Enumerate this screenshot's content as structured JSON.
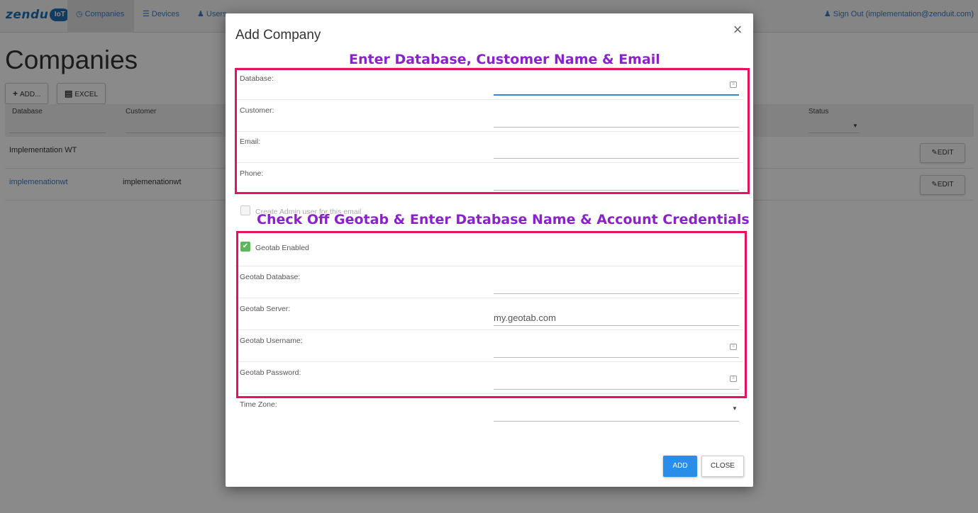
{
  "nav": {
    "brand": "zendu",
    "brand_badge": "IoT",
    "items": [
      {
        "label": "Companies",
        "icon": "clock"
      },
      {
        "label": "Devices",
        "icon": "list"
      },
      {
        "label": "Users",
        "icon": "user"
      }
    ],
    "signout": "Sign Out (implementation@zenduit.com)"
  },
  "page": {
    "title": "Companies",
    "add_label": "ADD...",
    "excel_label": "EXCEL",
    "columns": [
      "Database",
      "Customer",
      "Status"
    ],
    "rows": [
      {
        "database": "Implementation WT",
        "customer": "",
        "action": "EDIT"
      },
      {
        "database": "implemenationwt",
        "customer": "implemenationwt",
        "action": "EDIT"
      }
    ]
  },
  "modal": {
    "title": "Add Company",
    "close_glyph": "×",
    "fields": {
      "database": {
        "label": "Database:",
        "value": ""
      },
      "customer": {
        "label": "Customer:",
        "value": ""
      },
      "email": {
        "label": "Email:",
        "value": ""
      },
      "phone": {
        "label": "Phone:",
        "value": ""
      }
    },
    "create_admin": {
      "label": "Create Admin user for this email",
      "checked": false
    },
    "geotab_enabled": {
      "label": "Geotab Enabled",
      "checked": true
    },
    "geotab_fields": {
      "database": {
        "label": "Geotab Database:",
        "value": ""
      },
      "server": {
        "label": "Geotab Server:",
        "value": "my.geotab.com"
      },
      "username": {
        "label": "Geotab Username:",
        "value": ""
      },
      "password": {
        "label": "Geotab Password:",
        "value": ""
      }
    },
    "timezone": {
      "label": "Time Zone:",
      "value": ""
    },
    "add_button": "ADD",
    "close_button": "CLOSE"
  },
  "annotations": {
    "top": "Enter Database, Customer Name & Email",
    "bottom": "Check Off Geotab & Enter Database Name & Account Credentials",
    "text_color": "#8a22c9",
    "box_color": "#e8115f"
  },
  "colors": {
    "primary": "#2a8ee8",
    "link": "#3a7bc8",
    "check": "#5cb85c"
  }
}
